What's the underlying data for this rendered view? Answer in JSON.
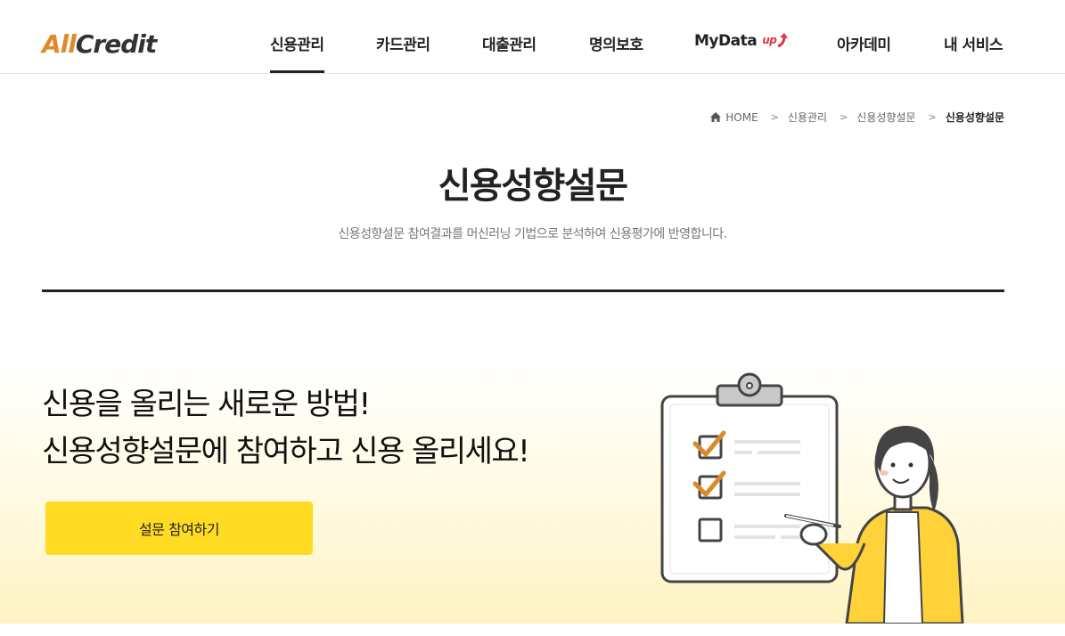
{
  "header": {
    "logo_part1": "All",
    "logo_part2": "Credit",
    "nav": [
      {
        "label": "신용관리",
        "active": true
      },
      {
        "label": "카드관리"
      },
      {
        "label": "대출관리"
      },
      {
        "label": "명의보호"
      },
      {
        "label": "MyData",
        "badge": "up"
      },
      {
        "label": "아카데미"
      },
      {
        "label": "내 서비스"
      }
    ]
  },
  "breadcrumb": {
    "home": "HOME",
    "items": [
      "신용관리",
      "신용성향설문"
    ],
    "current": "신용성향설문"
  },
  "page": {
    "title": "신용성향설문",
    "description": "신용성향설문 참여결과를 머신러닝 기법으로 분석하여 신용평가에 반영합니다."
  },
  "hero": {
    "line1": "신용을 올리는 새로운 방법!",
    "line2": "신용성향설문에 참여하고 신용 올리세요!",
    "cta_label": "설문 참여하기"
  },
  "colors": {
    "accent": "#ffdc23",
    "logo_orange": "#e08a2b",
    "checkmark": "#d98a2a"
  }
}
